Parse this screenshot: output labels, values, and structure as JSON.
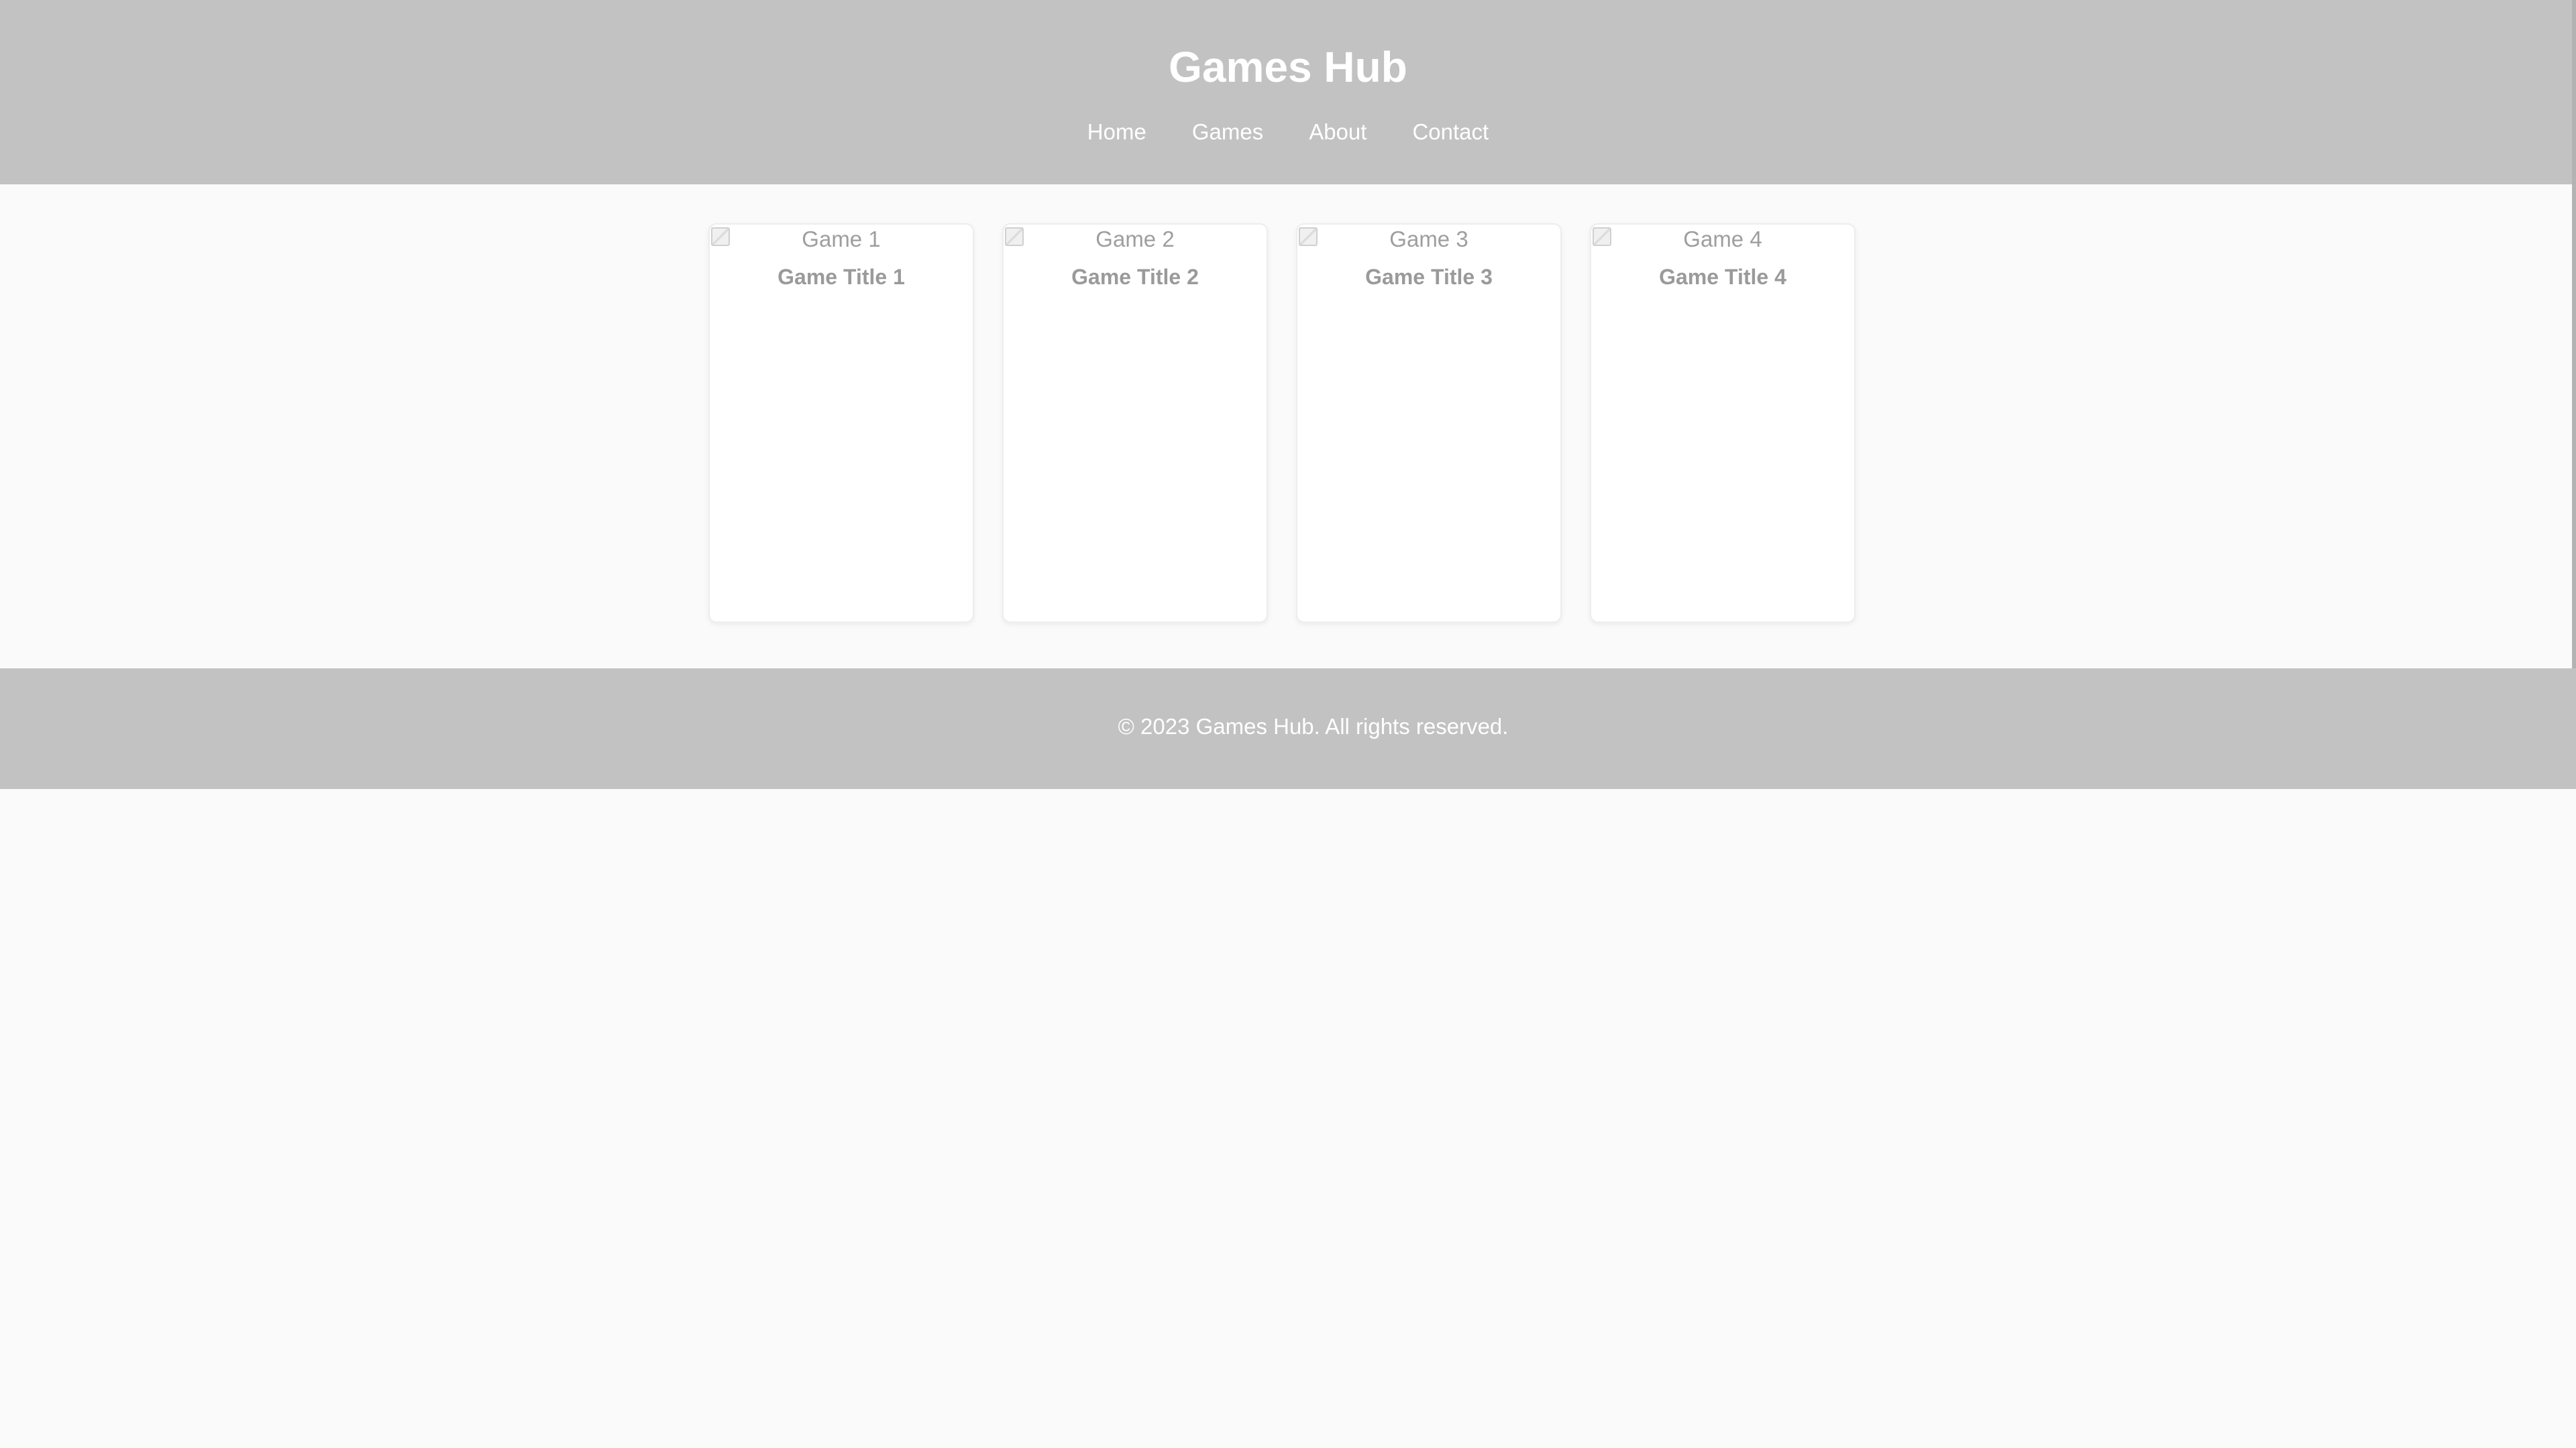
{
  "header": {
    "title": "Games Hub",
    "nav": [
      {
        "label": "Home"
      },
      {
        "label": "Games"
      },
      {
        "label": "About"
      },
      {
        "label": "Contact"
      }
    ]
  },
  "games": [
    {
      "image_alt": "Game 1",
      "title": "Game Title 1"
    },
    {
      "image_alt": "Game 2",
      "title": "Game Title 2"
    },
    {
      "image_alt": "Game 3",
      "title": "Game Title 3"
    },
    {
      "image_alt": "Game 4",
      "title": "Game Title 4"
    }
  ],
  "footer": {
    "text": "© 2023 Games Hub. All rights reserved."
  },
  "colors": {
    "header_bg": "#c2c2c2",
    "footer_bg": "#c2c2c2",
    "page_bg": "#fafafa",
    "card_bg": "#ffffff"
  }
}
